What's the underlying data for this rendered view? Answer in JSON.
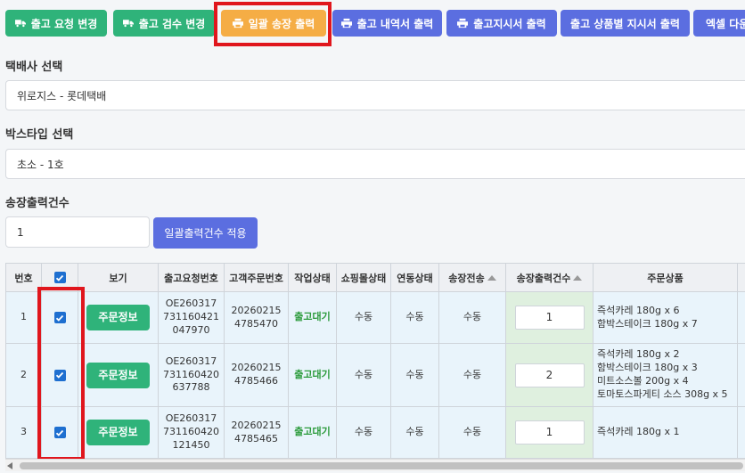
{
  "toolbar": {
    "buttons": [
      {
        "label": "출고 요청 변경",
        "icon": "truck-icon",
        "color": "#2fb37a"
      },
      {
        "label": "출고 검수 변경",
        "icon": "truck-icon",
        "color": "#2fb37a"
      },
      {
        "label": "일괄 송장 출력",
        "icon": "printer-icon",
        "color": "#f5ad45"
      },
      {
        "label": "출고 내역서 출력",
        "icon": "printer-icon",
        "color": "#5b6ee0"
      },
      {
        "label": "출고지시서 출력",
        "icon": "printer-icon",
        "color": "#5b6ee0"
      },
      {
        "label": "출고 상품별 지시서 출력",
        "icon": "",
        "color": "#5b6ee0"
      },
      {
        "label": "엑셀 다운",
        "icon": "",
        "color": "#5b6ee0"
      }
    ]
  },
  "courier": {
    "label": "택배사 선택",
    "value": "위로지스 - 롯데택배"
  },
  "box": {
    "label": "박스타입 선택",
    "value": "초소 - 1호"
  },
  "count": {
    "label": "송장출력건수",
    "value": "1",
    "apply_label": "일괄출력건수 적용"
  },
  "table": {
    "headers": {
      "no": "번호",
      "view": "보기",
      "req_no": "출고요청번호",
      "cust_no": "고객주문번호",
      "work": "작업상태",
      "mall": "쇼핑몰상태",
      "link": "연동상태",
      "send": "송장전송",
      "print": "송장출력건수",
      "items": "주문상품"
    },
    "order_btn_label": "주문정보",
    "rows": [
      {
        "no": "1",
        "req1": "OE260317",
        "req2": "731160421",
        "req3": "047970",
        "cust1": "20260215",
        "cust2": "4785470",
        "work": "출고대기",
        "mall": "수동",
        "link": "수동",
        "send": "수동",
        "print": "1",
        "items": [
          "즉석카레 180g x 6",
          "함박스테이크 180g x 7"
        ]
      },
      {
        "no": "2",
        "req1": "OE260317",
        "req2": "731160420",
        "req3": "637788",
        "cust1": "20260215",
        "cust2": "4785466",
        "work": "출고대기",
        "mall": "수동",
        "link": "수동",
        "send": "수동",
        "print": "2",
        "items": [
          "즉석카레 180g x 2",
          "함박스테이크 180g x 3",
          "미트소스볼 200g x 4",
          "토마토스파게티 소스 308g x 5"
        ]
      },
      {
        "no": "3",
        "req1": "OE260317",
        "req2": "731160420",
        "req3": "121450",
        "cust1": "20260215",
        "cust2": "4785465",
        "work": "출고대기",
        "mall": "수동",
        "link": "수동",
        "send": "수동",
        "print": "1",
        "items": [
          "즉석카레 180g x 1"
        ]
      }
    ]
  },
  "colors": {
    "highlight": "#e0161d",
    "status_green": "#2a9a3a",
    "checkbox": "#1e6fd0"
  }
}
